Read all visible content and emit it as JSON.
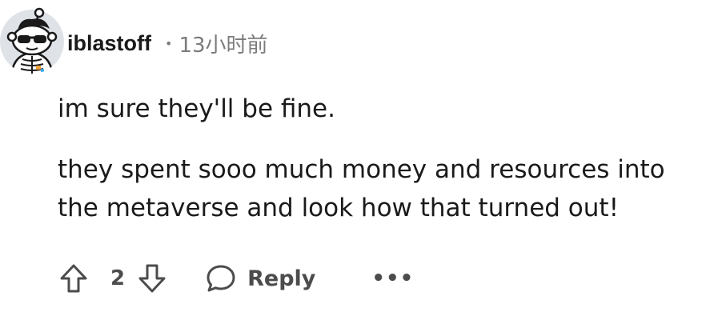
{
  "comment": {
    "author": "iblastoff",
    "separator": "•",
    "timestamp": "13小时前",
    "paragraphs": [
      "im sure they'll be fine.",
      "they spent sooo much money and resources into the metaverse and look how that turned out!"
    ],
    "score": "2",
    "avatar_icon": "snoo-avatar-sunglasses-icon"
  },
  "actions": {
    "upvote_icon": "upvote-arrow-icon",
    "downvote_icon": "downvote-arrow-icon",
    "reply_icon": "speech-bubble-icon",
    "reply_label": "Reply",
    "more_label": "•••"
  },
  "colors": {
    "text_primary": "#1a1a1b",
    "text_meta": "#7c7c7c",
    "action_gray": "#4c4c4c"
  }
}
